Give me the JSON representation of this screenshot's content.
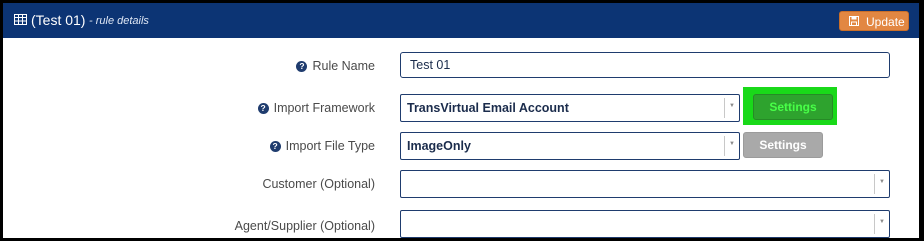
{
  "header": {
    "title": "(Test 01)",
    "subtitle": "- rule details",
    "update_label": "Update",
    "icons": {
      "title": "table-icon",
      "update": "floppy-disk-icon"
    },
    "colors": {
      "bar": "#0c3474",
      "update_button": "#e28742"
    }
  },
  "form": {
    "rule_name": {
      "label": "Rule Name",
      "value": "Test 01"
    },
    "import_framework": {
      "label": "Import Framework",
      "value": "TransVirtual Email Account",
      "settings_label": "Settings"
    },
    "import_file_type": {
      "label": "Import File Type",
      "value": "ImageOnly",
      "settings_label": "Settings"
    },
    "customer": {
      "label": "Customer (Optional)",
      "value": ""
    },
    "agent_supplier": {
      "label": "Agent/Supplier (Optional)",
      "value": ""
    },
    "help_icon": "question-circle-icon"
  },
  "colors": {
    "highlight": "#19d919",
    "settings_active": "#2ea32e",
    "settings_disabled": "#a9a9a9"
  }
}
